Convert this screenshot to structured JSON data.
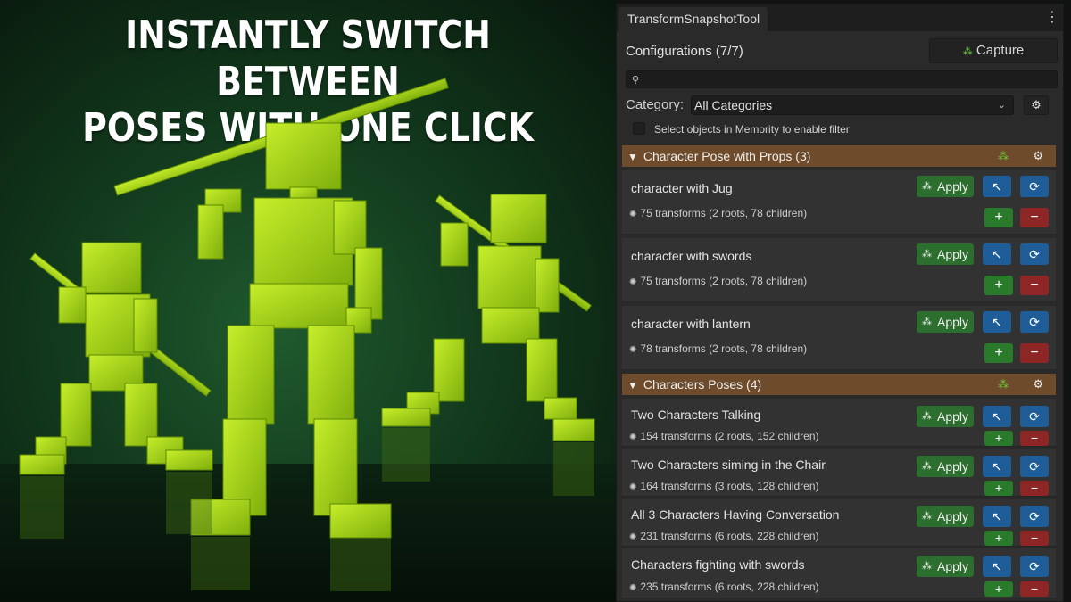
{
  "promo": {
    "title_line1": "INSTANTLY SWITCH BETWEEN",
    "title_line2": "POSES WITH ONE CLICK"
  },
  "window": {
    "tab_title": "TransformSnapshotTool",
    "menu_icon": "kebab-menu-icon"
  },
  "toolbar": {
    "configurations_label": "Configurations (7/7)",
    "capture_label": "Capture",
    "search_placeholder": "",
    "category_label": "Category:",
    "category_value": "All Categories",
    "filter_note": "Select objects in Memority to enable filter"
  },
  "groups": [
    {
      "title": "Character Pose with Props (3)",
      "items": [
        {
          "name": "character with Jug",
          "stats": "75 transforms (2 roots, 78 children)"
        },
        {
          "name": "character with swords",
          "stats": "75 transforms (2 roots, 78 children)"
        },
        {
          "name": "character with lantern",
          "stats": "78 transforms (2 roots, 78 children)"
        }
      ]
    },
    {
      "title": "Characters Poses (4)",
      "items": [
        {
          "name": "Two Characters Talking",
          "stats": "154 transforms (2 roots, 152 children)"
        },
        {
          "name": "Two Characters siming in the Chair",
          "stats": "164 transforms (3 roots, 128 children)"
        },
        {
          "name": "All 3 Characters Having Conversation",
          "stats": "231 transforms (6 roots, 228 children)"
        },
        {
          "name": "Characters fighting with swords",
          "stats": "235 transforms (6 roots, 228 children)"
        }
      ]
    }
  ],
  "buttons": {
    "apply_label": "Apply",
    "add_label": "+",
    "remove_label": "−"
  },
  "colors": {
    "apply_green": "#2c6e2d",
    "action_blue": "#1e5d97",
    "remove_red": "#8e2626",
    "group_header_brown": "#6e4b2a",
    "figure_lime": "#9ccc12"
  }
}
